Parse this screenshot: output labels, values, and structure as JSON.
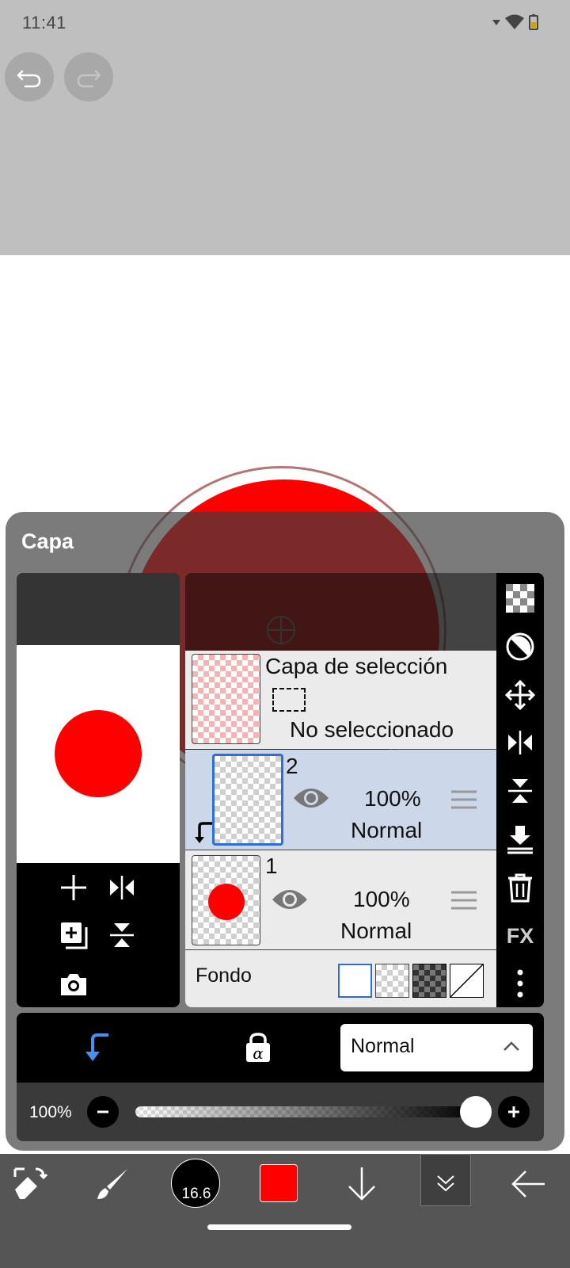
{
  "status_bar": {
    "time": "11:41"
  },
  "panel": {
    "title": "Capa"
  },
  "layers": {
    "selection_layer": {
      "title": "Capa de selección",
      "status": "No seleccionado"
    },
    "items": [
      {
        "name": "2",
        "opacity": "100%",
        "blend": "Normal",
        "selected": true
      },
      {
        "name": "1",
        "opacity": "100%",
        "blend": "Normal",
        "selected": false
      }
    ],
    "background": {
      "label": "Fondo"
    }
  },
  "sidebar": {
    "fx_label": "FX"
  },
  "blend_mode": {
    "value": "Normal"
  },
  "opacity": {
    "value_label": "100%",
    "level": 1.0
  },
  "bottom_toolbar": {
    "brush_size": "16.6",
    "current_color": "#ff0000"
  },
  "colors": {
    "accent_blue": "#2f6fcf",
    "selected_row": "#ccd8ea",
    "canvas_red": "#ff0000"
  }
}
